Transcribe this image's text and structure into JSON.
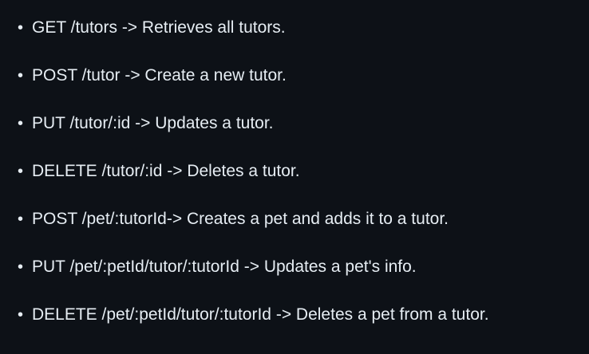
{
  "routes": [
    {
      "text": "GET /tutors -> Retrieves all tutors."
    },
    {
      "text": "POST /tutor -> Create a new tutor."
    },
    {
      "text": "PUT /tutor/:id -> Updates a tutor."
    },
    {
      "text": "DELETE /tutor/:id -> Deletes a tutor."
    },
    {
      "text": "POST /pet/:tutorId-> Creates a pet and adds it to a tutor."
    },
    {
      "text": "PUT /pet/:petId/tutor/:tutorId -> Updates a pet's info."
    },
    {
      "text": "DELETE /pet/:petId/tutor/:tutorId -> Deletes a pet from a tutor."
    }
  ],
  "colors": {
    "background": "#0d1117",
    "text": "#e6edf3"
  }
}
